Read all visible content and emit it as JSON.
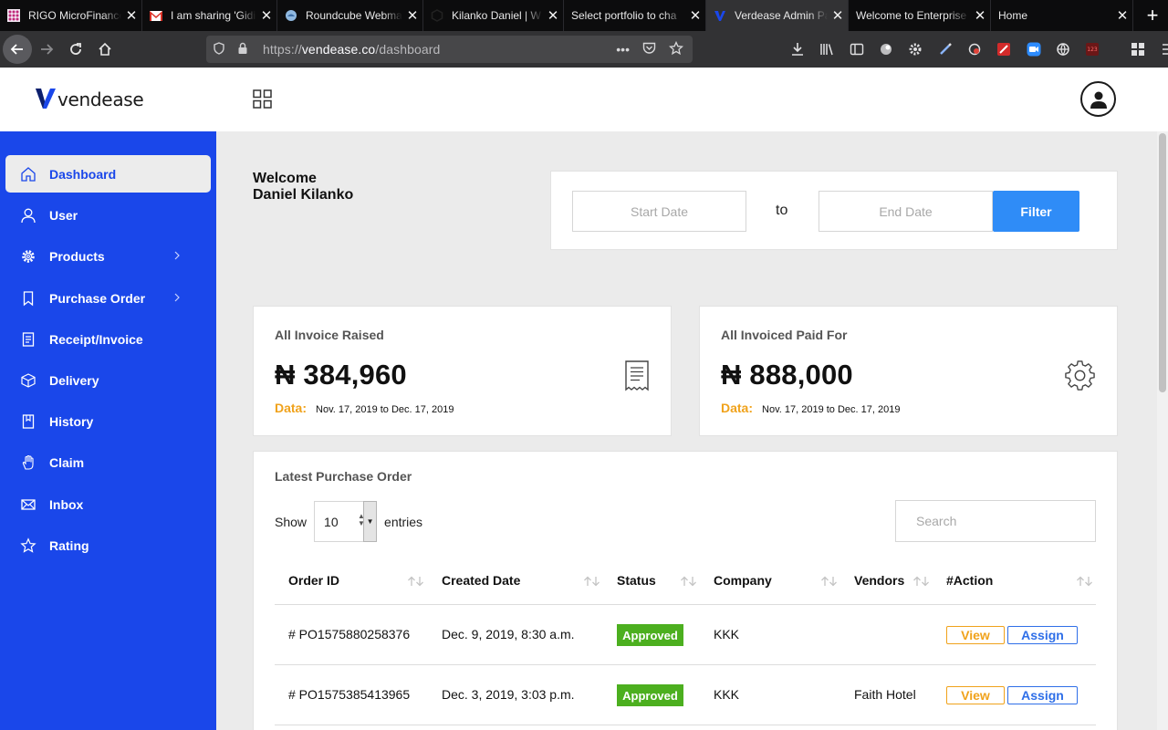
{
  "browser": {
    "tabs": [
      {
        "title": "RIGO MicroFinance",
        "favicon": "grid-favicon",
        "active": false
      },
      {
        "title": "I am sharing 'Gidi",
        "favicon": "gmail-favicon",
        "active": false
      },
      {
        "title": "Roundcube Webmail",
        "favicon": "roundcube-favicon",
        "active": false
      },
      {
        "title": "Kilanko Daniel | W",
        "favicon": "hex-favicon",
        "active": false
      },
      {
        "title": "Select portfolio to cha",
        "favicon": "",
        "active": false
      },
      {
        "title": "Verdease Admin Pa",
        "favicon": "vendease-favicon",
        "active": true
      },
      {
        "title": "Welcome to Enterprise",
        "favicon": "",
        "active": false
      },
      {
        "title": "Home",
        "favicon": "",
        "active": false
      }
    ],
    "url": {
      "scheme": "https://",
      "host": "vendease.co",
      "path": "/dashboard"
    }
  },
  "header": {
    "logo_text": "vendease"
  },
  "sidebar": {
    "items": [
      {
        "label": "Dashboard",
        "icon": "home-icon",
        "active": true,
        "chevron": false
      },
      {
        "label": "User",
        "icon": "user-icon",
        "active": false,
        "chevron": false
      },
      {
        "label": "Products",
        "icon": "gear-icon",
        "active": false,
        "chevron": true
      },
      {
        "label": "Purchase Order",
        "icon": "bookmark-icon",
        "active": false,
        "chevron": true
      },
      {
        "label": "Receipt/Invoice",
        "icon": "receipt-icon",
        "active": false,
        "chevron": false
      },
      {
        "label": "Delivery",
        "icon": "box-icon",
        "active": false,
        "chevron": false
      },
      {
        "label": "History",
        "icon": "history-icon",
        "active": false,
        "chevron": false
      },
      {
        "label": "Claim",
        "icon": "hand-icon",
        "active": false,
        "chevron": false
      },
      {
        "label": "Inbox",
        "icon": "mail-icon",
        "active": false,
        "chevron": false
      },
      {
        "label": "Rating",
        "icon": "star-icon",
        "active": false,
        "chevron": false
      }
    ]
  },
  "welcome": {
    "line1": "Welcome",
    "line2": "Daniel Kilanko"
  },
  "filter": {
    "start_placeholder": "Start Date",
    "to_label": "to",
    "end_placeholder": "End Date",
    "button_label": "Filter"
  },
  "stats": [
    {
      "title": "All Invoice Raised",
      "amount": "₦ 384,960",
      "date_label": "Data:",
      "date_range": "Nov. 17, 2019 to Dec. 17, 2019",
      "icon": "receipt-icon"
    },
    {
      "title": "All Invoiced Paid For",
      "amount": "₦ 888,000",
      "date_label": "Data:",
      "date_range": "Nov. 17, 2019 to Dec. 17, 2019",
      "icon": "gear-icon"
    }
  ],
  "purchase_orders": {
    "title": "Latest Purchase Order",
    "show_label": "Show",
    "entries_value": "10",
    "entries_label": "entries",
    "search_placeholder": "Search",
    "columns": [
      "Order ID",
      "Created Date",
      "Status",
      "Company",
      "Vendors",
      "#Action"
    ],
    "rows": [
      {
        "order_id": "# PO1575880258376",
        "created": "Dec. 9, 2019, 8:30 a.m.",
        "status": "Approved",
        "company": "KKK",
        "vendor": "",
        "view": "View",
        "assign": "Assign"
      },
      {
        "order_id": "# PO1575385413965",
        "created": "Dec. 3, 2019, 3:03 p.m.",
        "status": "Approved",
        "company": "KKK",
        "vendor": "Faith Hotel",
        "view": "View",
        "assign": "Assign"
      }
    ]
  },
  "colors": {
    "sidebar_bg": "#1a47ea",
    "filter_button": "#2f8cf7",
    "status_approved": "#4caf1f",
    "view_orange": "#f0a21b",
    "assign_blue": "#2f6fe8"
  }
}
